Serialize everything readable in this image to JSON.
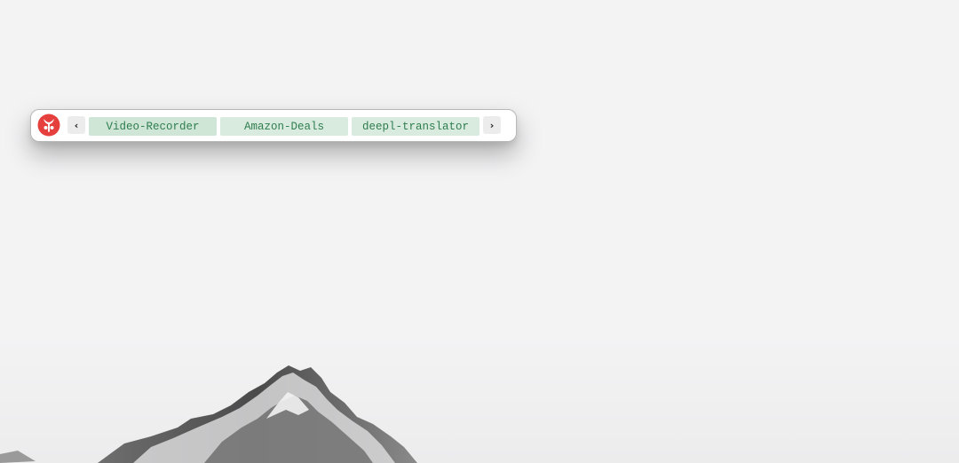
{
  "toolbar": {
    "logo_icon": "app-logo-icon",
    "prev_label": "‹",
    "next_label": "›",
    "tabs": [
      {
        "label": "Video-Recorder",
        "active": true
      },
      {
        "label": "Amazon-Deals",
        "active": false
      },
      {
        "label": "deepl-translator",
        "active": false
      }
    ]
  },
  "colors": {
    "logo": "#e5403e",
    "tab_text": "#2e7d4f",
    "tab_active_bg": "#cfe6d6",
    "tab_bg": "#d9ebdf",
    "desktop_bg": "#f3f3f4"
  },
  "wallpaper": {
    "subject": "snow-mountain"
  }
}
